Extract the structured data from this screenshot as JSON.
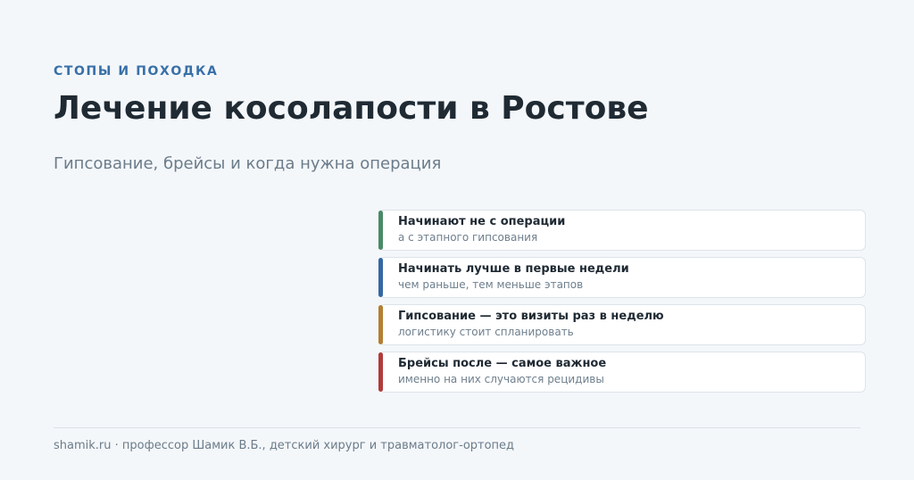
{
  "header": {
    "eyebrow": "СТОПЫ И ПОХОДКА",
    "title": "Лечение косолапости в Ростове",
    "subtitle": "Гипсование, брейсы и когда нужна операция"
  },
  "cards": [
    {
      "title": "Начинают не с операции",
      "subtitle": "а с этапного гипсования",
      "accent": "#4a8a66"
    },
    {
      "title": "Начинать лучше в первые недели",
      "subtitle": "чем раньше, тем меньше этапов",
      "accent": "#3567a3"
    },
    {
      "title": "Гипсование — это визиты раз в неделю",
      "subtitle": "логистику стоит спланировать",
      "accent": "#b37f31"
    },
    {
      "title": "Брейсы после — самое важное",
      "subtitle": "именно на них случаются рецидивы",
      "accent": "#b23a3a"
    }
  ],
  "footer": {
    "text": "shamik.ru · профессор Шамик В.Б., детский хирург и травматолог-ортопед"
  }
}
